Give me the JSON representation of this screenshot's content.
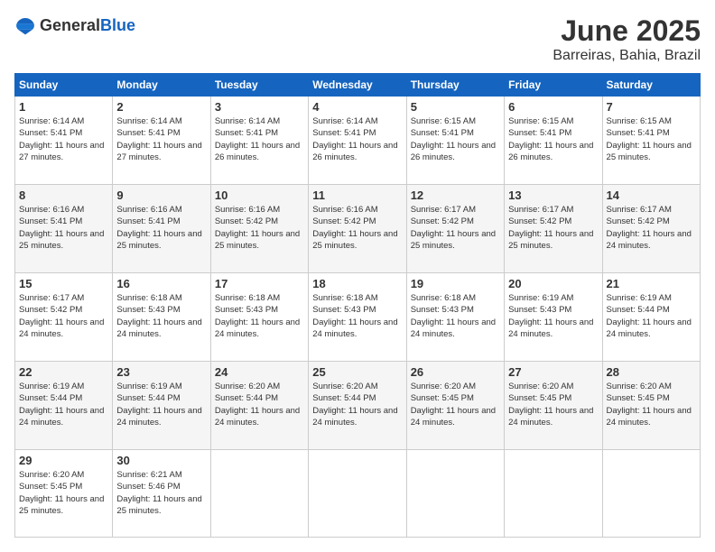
{
  "logo": {
    "general": "General",
    "blue": "Blue"
  },
  "title": "June 2025",
  "location": "Barreiras, Bahia, Brazil",
  "headers": [
    "Sunday",
    "Monday",
    "Tuesday",
    "Wednesday",
    "Thursday",
    "Friday",
    "Saturday"
  ],
  "weeks": [
    [
      {
        "day": "1",
        "sunrise": "6:14 AM",
        "sunset": "5:41 PM",
        "daylight": "11 hours and 27 minutes."
      },
      {
        "day": "2",
        "sunrise": "6:14 AM",
        "sunset": "5:41 PM",
        "daylight": "11 hours and 27 minutes."
      },
      {
        "day": "3",
        "sunrise": "6:14 AM",
        "sunset": "5:41 PM",
        "daylight": "11 hours and 26 minutes."
      },
      {
        "day": "4",
        "sunrise": "6:14 AM",
        "sunset": "5:41 PM",
        "daylight": "11 hours and 26 minutes."
      },
      {
        "day": "5",
        "sunrise": "6:15 AM",
        "sunset": "5:41 PM",
        "daylight": "11 hours and 26 minutes."
      },
      {
        "day": "6",
        "sunrise": "6:15 AM",
        "sunset": "5:41 PM",
        "daylight": "11 hours and 26 minutes."
      },
      {
        "day": "7",
        "sunrise": "6:15 AM",
        "sunset": "5:41 PM",
        "daylight": "11 hours and 25 minutes."
      }
    ],
    [
      {
        "day": "8",
        "sunrise": "6:16 AM",
        "sunset": "5:41 PM",
        "daylight": "11 hours and 25 minutes."
      },
      {
        "day": "9",
        "sunrise": "6:16 AM",
        "sunset": "5:41 PM",
        "daylight": "11 hours and 25 minutes."
      },
      {
        "day": "10",
        "sunrise": "6:16 AM",
        "sunset": "5:42 PM",
        "daylight": "11 hours and 25 minutes."
      },
      {
        "day": "11",
        "sunrise": "6:16 AM",
        "sunset": "5:42 PM",
        "daylight": "11 hours and 25 minutes."
      },
      {
        "day": "12",
        "sunrise": "6:17 AM",
        "sunset": "5:42 PM",
        "daylight": "11 hours and 25 minutes."
      },
      {
        "day": "13",
        "sunrise": "6:17 AM",
        "sunset": "5:42 PM",
        "daylight": "11 hours and 25 minutes."
      },
      {
        "day": "14",
        "sunrise": "6:17 AM",
        "sunset": "5:42 PM",
        "daylight": "11 hours and 24 minutes."
      }
    ],
    [
      {
        "day": "15",
        "sunrise": "6:17 AM",
        "sunset": "5:42 PM",
        "daylight": "11 hours and 24 minutes."
      },
      {
        "day": "16",
        "sunrise": "6:18 AM",
        "sunset": "5:43 PM",
        "daylight": "11 hours and 24 minutes."
      },
      {
        "day": "17",
        "sunrise": "6:18 AM",
        "sunset": "5:43 PM",
        "daylight": "11 hours and 24 minutes."
      },
      {
        "day": "18",
        "sunrise": "6:18 AM",
        "sunset": "5:43 PM",
        "daylight": "11 hours and 24 minutes."
      },
      {
        "day": "19",
        "sunrise": "6:18 AM",
        "sunset": "5:43 PM",
        "daylight": "11 hours and 24 minutes."
      },
      {
        "day": "20",
        "sunrise": "6:19 AM",
        "sunset": "5:43 PM",
        "daylight": "11 hours and 24 minutes."
      },
      {
        "day": "21",
        "sunrise": "6:19 AM",
        "sunset": "5:44 PM",
        "daylight": "11 hours and 24 minutes."
      }
    ],
    [
      {
        "day": "22",
        "sunrise": "6:19 AM",
        "sunset": "5:44 PM",
        "daylight": "11 hours and 24 minutes."
      },
      {
        "day": "23",
        "sunrise": "6:19 AM",
        "sunset": "5:44 PM",
        "daylight": "11 hours and 24 minutes."
      },
      {
        "day": "24",
        "sunrise": "6:20 AM",
        "sunset": "5:44 PM",
        "daylight": "11 hours and 24 minutes."
      },
      {
        "day": "25",
        "sunrise": "6:20 AM",
        "sunset": "5:44 PM",
        "daylight": "11 hours and 24 minutes."
      },
      {
        "day": "26",
        "sunrise": "6:20 AM",
        "sunset": "5:45 PM",
        "daylight": "11 hours and 24 minutes."
      },
      {
        "day": "27",
        "sunrise": "6:20 AM",
        "sunset": "5:45 PM",
        "daylight": "11 hours and 24 minutes."
      },
      {
        "day": "28",
        "sunrise": "6:20 AM",
        "sunset": "5:45 PM",
        "daylight": "11 hours and 24 minutes."
      }
    ],
    [
      {
        "day": "29",
        "sunrise": "6:20 AM",
        "sunset": "5:45 PM",
        "daylight": "11 hours and 25 minutes."
      },
      {
        "day": "30",
        "sunrise": "6:21 AM",
        "sunset": "5:46 PM",
        "daylight": "11 hours and 25 minutes."
      },
      null,
      null,
      null,
      null,
      null
    ]
  ],
  "labels": {
    "sunrise": "Sunrise:",
    "sunset": "Sunset:",
    "daylight": "Daylight:"
  }
}
